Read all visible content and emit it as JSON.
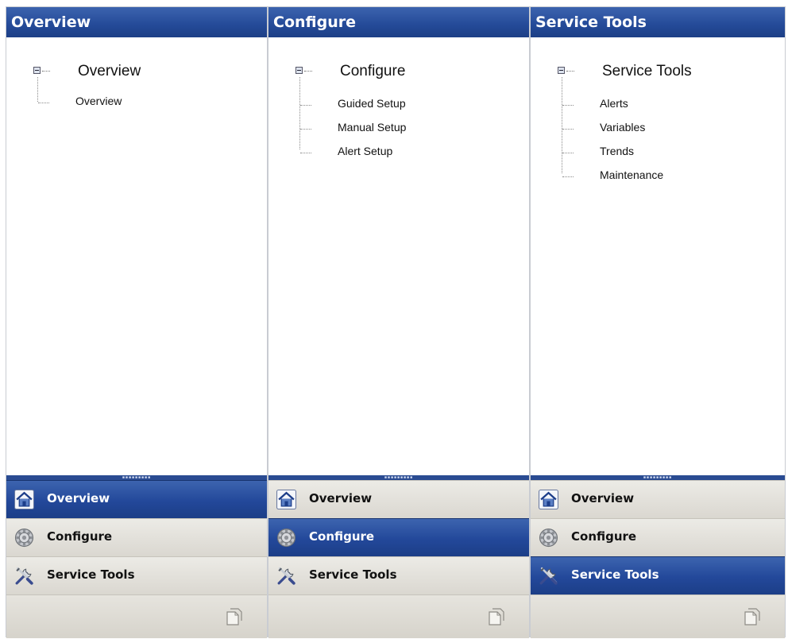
{
  "panels": [
    {
      "title": "Overview",
      "tree": {
        "root": "Overview",
        "children": [
          "Overview"
        ]
      },
      "nav": {
        "overview": "Overview",
        "configure": "Configure",
        "service_tools": "Service Tools"
      },
      "active": "overview"
    },
    {
      "title": "Configure",
      "tree": {
        "root": "Configure",
        "children": [
          "Guided Setup",
          "Manual Setup",
          "Alert Setup"
        ]
      },
      "nav": {
        "overview": "Overview",
        "configure": "Configure",
        "service_tools": "Service Tools"
      },
      "active": "configure"
    },
    {
      "title": "Service Tools",
      "tree": {
        "root": "Service Tools",
        "children": [
          "Alerts",
          "Variables",
          "Trends",
          "Maintenance"
        ]
      },
      "nav": {
        "overview": "Overview",
        "configure": "Configure",
        "service_tools": "Service Tools"
      },
      "active": "service_tools"
    }
  ],
  "icons": {
    "overview": "home-icon",
    "configure": "gear-icon",
    "service_tools": "tools-icon",
    "footer": "copy-icon"
  },
  "colors": {
    "header_blue": "#2a4b92",
    "active_blue": "#23489a",
    "inactive_gray": "#e3e1db"
  }
}
